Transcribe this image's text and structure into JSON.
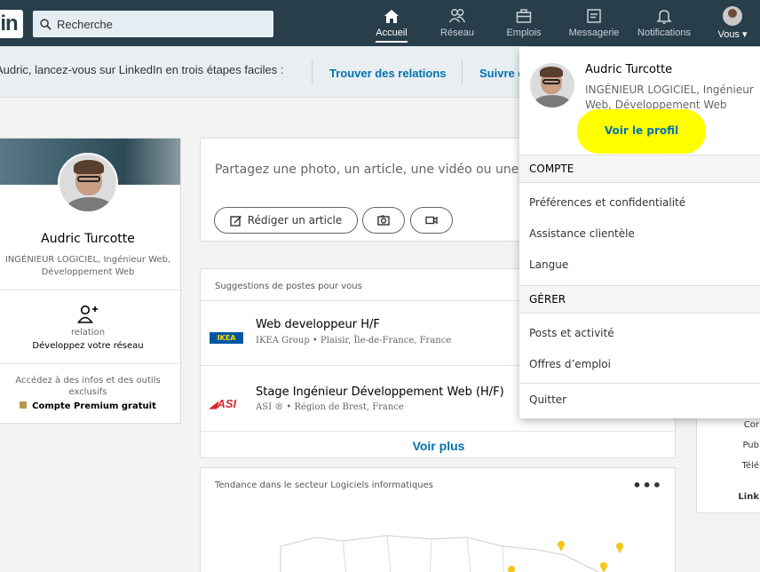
{
  "nav": {
    "logo": "in",
    "search_placeholder": "Recherche",
    "items": [
      {
        "label": "Accueil",
        "icon": "home-icon",
        "active": true
      },
      {
        "label": "Réseau",
        "icon": "network-icon"
      },
      {
        "label": "Emplois",
        "icon": "briefcase-icon"
      },
      {
        "label": "Messagerie",
        "icon": "messaging-icon"
      },
      {
        "label": "Notifications",
        "icon": "bell-icon"
      },
      {
        "label": "Vous ▾",
        "icon": "avatar"
      }
    ]
  },
  "onboarding": {
    "message": "Audric, lancez-vous sur LinkedIn en trois étapes faciles :",
    "link1": "Trouver des relations",
    "link2": "Suivre d"
  },
  "profile": {
    "name": "Audric Turcotte",
    "title": "INGÉNIEUR LOGICIEL, Ingénieur Web, Développement Web",
    "relation": "relation",
    "grow": "Développez votre réseau",
    "access": "Accédez à des infos et des outils exclusifs",
    "premium": "Compte Premium gratuit"
  },
  "share": {
    "prompt": "Partagez une photo, un article, une vidéo ou une idée",
    "write_article": "Rédiger un article"
  },
  "jobs": {
    "header": "Suggestions de postes pour vous",
    "items": [
      {
        "title": "Web developpeur H/F",
        "subtitle": "IKEA Group • Plaisir, Île-de-France, France",
        "logo": "IKEA"
      },
      {
        "title": "Stage Ingénieur Développement Web (H/F)",
        "subtitle": "ASI ® • Région de Brest, France",
        "logo": "ASI"
      }
    ],
    "more": "Voir plus"
  },
  "trend": {
    "header": "Tendance dans le secteur Logiciels informatiques",
    "menu": "•••"
  },
  "rail": {
    "items": [
      "Cor",
      "Pub",
      "Télé",
      "Link"
    ]
  },
  "dropdown": {
    "name": "Audric Turcotte",
    "title": "INGÉNIEUR LOGICIEL, Ingénieur Web, Développement Web",
    "view_profile": "Voir le profil",
    "section_account": "COMPTE",
    "account_items": [
      "Préférences et confidentialité",
      "Assistance clientèle",
      "Langue"
    ],
    "section_manage": "GÉRER",
    "manage_items": [
      "Posts et activité",
      "Offres d’emploi"
    ],
    "quit": "Quitter"
  },
  "colors": {
    "nav_bg": "#283e4a",
    "link": "#0073b1",
    "highlight": "#ffff00"
  }
}
